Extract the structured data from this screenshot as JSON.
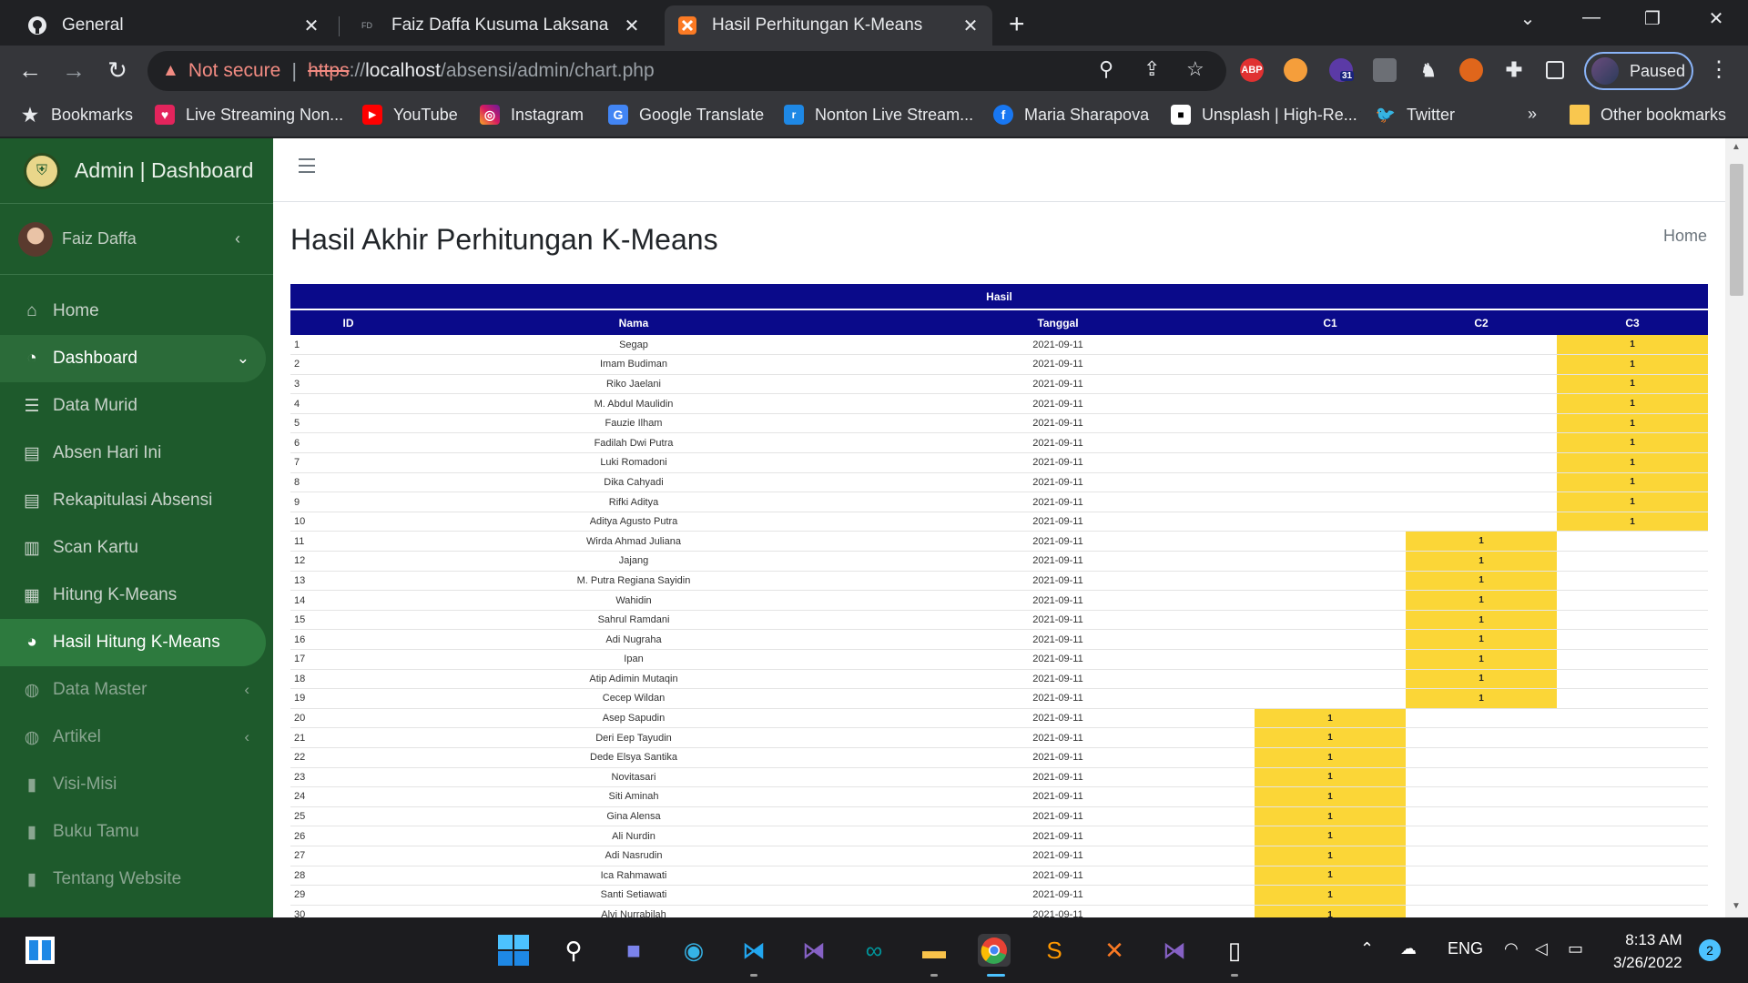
{
  "browser": {
    "tabs": [
      {
        "title": "General",
        "icon": "github-icon",
        "active": false
      },
      {
        "title": "Faiz Daffa Kusuma Laksana",
        "icon": "fd-icon",
        "active": false
      },
      {
        "title": "Hasil Perhitungan K-Means",
        "icon": "xampp-icon",
        "active": true
      }
    ],
    "security_label": "Not secure",
    "url_scheme": "https",
    "url_sep": "://",
    "url_host": "localhost",
    "url_path": "/absensi/admin/chart.php",
    "profile_label": "Paused",
    "ext_badge": "31",
    "abp_label": "ABP",
    "bookmarks": [
      {
        "label": "Bookmarks",
        "icon": "star-icon"
      },
      {
        "label": "Live Streaming Non...",
        "icon": "vidio-icon"
      },
      {
        "label": "YouTube",
        "icon": "youtube-icon"
      },
      {
        "label": "Instagram",
        "icon": "instagram-icon"
      },
      {
        "label": "Google Translate",
        "icon": "translate-icon"
      },
      {
        "label": "Nonton Live Stream...",
        "icon": "stream-icon"
      },
      {
        "label": "Maria Sharapova",
        "icon": "facebook-icon"
      },
      {
        "label": "Unsplash | High-Re...",
        "icon": "unsplash-icon"
      },
      {
        "label": "Twitter",
        "icon": "twitter-icon"
      }
    ],
    "overflow_label": "»",
    "other_bookmarks": "Other bookmarks"
  },
  "sidebar": {
    "brand": "Admin | Dashboard",
    "user": "Faiz Daffa",
    "items": [
      {
        "label": "Home",
        "icon": "home-icon",
        "state": "normal"
      },
      {
        "label": "Dashboard",
        "icon": "dashboard-icon",
        "state": "dash"
      },
      {
        "label": "Data Murid",
        "icon": "database-icon",
        "state": "normal"
      },
      {
        "label": "Absen Hari Ini",
        "icon": "list-icon",
        "state": "normal"
      },
      {
        "label": "Rekapitulasi Absensi",
        "icon": "list-icon",
        "state": "normal"
      },
      {
        "label": "Scan Kartu",
        "icon": "barcode-icon",
        "state": "normal"
      },
      {
        "label": "Hitung K-Means",
        "icon": "calculator-icon",
        "state": "normal"
      },
      {
        "label": "Hasil Hitung K-Means",
        "icon": "pie-chart-icon",
        "state": "active"
      },
      {
        "label": "Data Master",
        "icon": "palette-icon",
        "state": "dim"
      },
      {
        "label": "Artikel",
        "icon": "palette-icon",
        "state": "dim"
      },
      {
        "label": "Visi-Misi",
        "icon": "file-icon",
        "state": "dim"
      },
      {
        "label": "Buku Tamu",
        "icon": "file-icon",
        "state": "dim"
      },
      {
        "label": "Tentang Website",
        "icon": "file-icon",
        "state": "dim"
      }
    ]
  },
  "page": {
    "title": "Hasil Akhir Perhitungan K-Means",
    "breadcrumb": "Home"
  },
  "table": {
    "group_header": "Hasil",
    "columns": [
      "ID",
      "Nama",
      "Tanggal",
      "C1",
      "C2",
      "C3"
    ],
    "rows": [
      {
        "id": "1",
        "nama": "Segap",
        "tanggal": "2021-09-11",
        "c1": "",
        "c2": "",
        "c3": "1"
      },
      {
        "id": "2",
        "nama": "Imam Budiman",
        "tanggal": "2021-09-11",
        "c1": "",
        "c2": "",
        "c3": "1"
      },
      {
        "id": "3",
        "nama": "Riko Jaelani",
        "tanggal": "2021-09-11",
        "c1": "",
        "c2": "",
        "c3": "1"
      },
      {
        "id": "4",
        "nama": "M. Abdul Maulidin",
        "tanggal": "2021-09-11",
        "c1": "",
        "c2": "",
        "c3": "1"
      },
      {
        "id": "5",
        "nama": "Fauzie Ilham",
        "tanggal": "2021-09-11",
        "c1": "",
        "c2": "",
        "c3": "1"
      },
      {
        "id": "6",
        "nama": "Fadilah Dwi Putra",
        "tanggal": "2021-09-11",
        "c1": "",
        "c2": "",
        "c3": "1"
      },
      {
        "id": "7",
        "nama": "Luki Romadoni",
        "tanggal": "2021-09-11",
        "c1": "",
        "c2": "",
        "c3": "1"
      },
      {
        "id": "8",
        "nama": "Dika Cahyadi",
        "tanggal": "2021-09-11",
        "c1": "",
        "c2": "",
        "c3": "1"
      },
      {
        "id": "9",
        "nama": "Rifki Aditya",
        "tanggal": "2021-09-11",
        "c1": "",
        "c2": "",
        "c3": "1"
      },
      {
        "id": "10",
        "nama": "Aditya Agusto Putra",
        "tanggal": "2021-09-11",
        "c1": "",
        "c2": "",
        "c3": "1"
      },
      {
        "id": "11",
        "nama": "Wirda Ahmad Juliana",
        "tanggal": "2021-09-11",
        "c1": "",
        "c2": "1",
        "c3": ""
      },
      {
        "id": "12",
        "nama": "Jajang",
        "tanggal": "2021-09-11",
        "c1": "",
        "c2": "1",
        "c3": ""
      },
      {
        "id": "13",
        "nama": "M. Putra Regiana Sayidin",
        "tanggal": "2021-09-11",
        "c1": "",
        "c2": "1",
        "c3": ""
      },
      {
        "id": "14",
        "nama": "Wahidin",
        "tanggal": "2021-09-11",
        "c1": "",
        "c2": "1",
        "c3": ""
      },
      {
        "id": "15",
        "nama": "Sahrul Ramdani",
        "tanggal": "2021-09-11",
        "c1": "",
        "c2": "1",
        "c3": ""
      },
      {
        "id": "16",
        "nama": "Adi Nugraha",
        "tanggal": "2021-09-11",
        "c1": "",
        "c2": "1",
        "c3": ""
      },
      {
        "id": "17",
        "nama": "Ipan",
        "tanggal": "2021-09-11",
        "c1": "",
        "c2": "1",
        "c3": ""
      },
      {
        "id": "18",
        "nama": "Atip Adimin Mutaqin",
        "tanggal": "2021-09-11",
        "c1": "",
        "c2": "1",
        "c3": ""
      },
      {
        "id": "19",
        "nama": "Cecep Wildan",
        "tanggal": "2021-09-11",
        "c1": "",
        "c2": "1",
        "c3": ""
      },
      {
        "id": "20",
        "nama": "Asep Sapudin",
        "tanggal": "2021-09-11",
        "c1": "1",
        "c2": "",
        "c3": ""
      },
      {
        "id": "21",
        "nama": "Deri Eep Tayudin",
        "tanggal": "2021-09-11",
        "c1": "1",
        "c2": "",
        "c3": ""
      },
      {
        "id": "22",
        "nama": "Dede Elsya Santika",
        "tanggal": "2021-09-11",
        "c1": "1",
        "c2": "",
        "c3": ""
      },
      {
        "id": "23",
        "nama": "Novitasari",
        "tanggal": "2021-09-11",
        "c1": "1",
        "c2": "",
        "c3": ""
      },
      {
        "id": "24",
        "nama": "Siti Aminah",
        "tanggal": "2021-09-11",
        "c1": "1",
        "c2": "",
        "c3": ""
      },
      {
        "id": "25",
        "nama": "Gina Alensa",
        "tanggal": "2021-09-11",
        "c1": "1",
        "c2": "",
        "c3": ""
      },
      {
        "id": "26",
        "nama": "Ali Nurdin",
        "tanggal": "2021-09-11",
        "c1": "1",
        "c2": "",
        "c3": ""
      },
      {
        "id": "27",
        "nama": "Adi Nasrudin",
        "tanggal": "2021-09-11",
        "c1": "1",
        "c2": "",
        "c3": ""
      },
      {
        "id": "28",
        "nama": "Ica Rahmawati",
        "tanggal": "2021-09-11",
        "c1": "1",
        "c2": "",
        "c3": ""
      },
      {
        "id": "29",
        "nama": "Santi Setiawati",
        "tanggal": "2021-09-11",
        "c1": "1",
        "c2": "",
        "c3": ""
      },
      {
        "id": "30",
        "nama": "Alvi Nurrabilah",
        "tanggal": "2021-09-11",
        "c1": "1",
        "c2": "",
        "c3": ""
      }
    ]
  },
  "taskbar": {
    "language": "ENG",
    "time": "8:13 AM",
    "date": "3/26/2022",
    "notification_count": "2"
  },
  "colors": {
    "sidebar_bg": "#1e5a2c",
    "table_header_bg": "#0a0a8a",
    "cluster_highlight": "#fbd637"
  }
}
